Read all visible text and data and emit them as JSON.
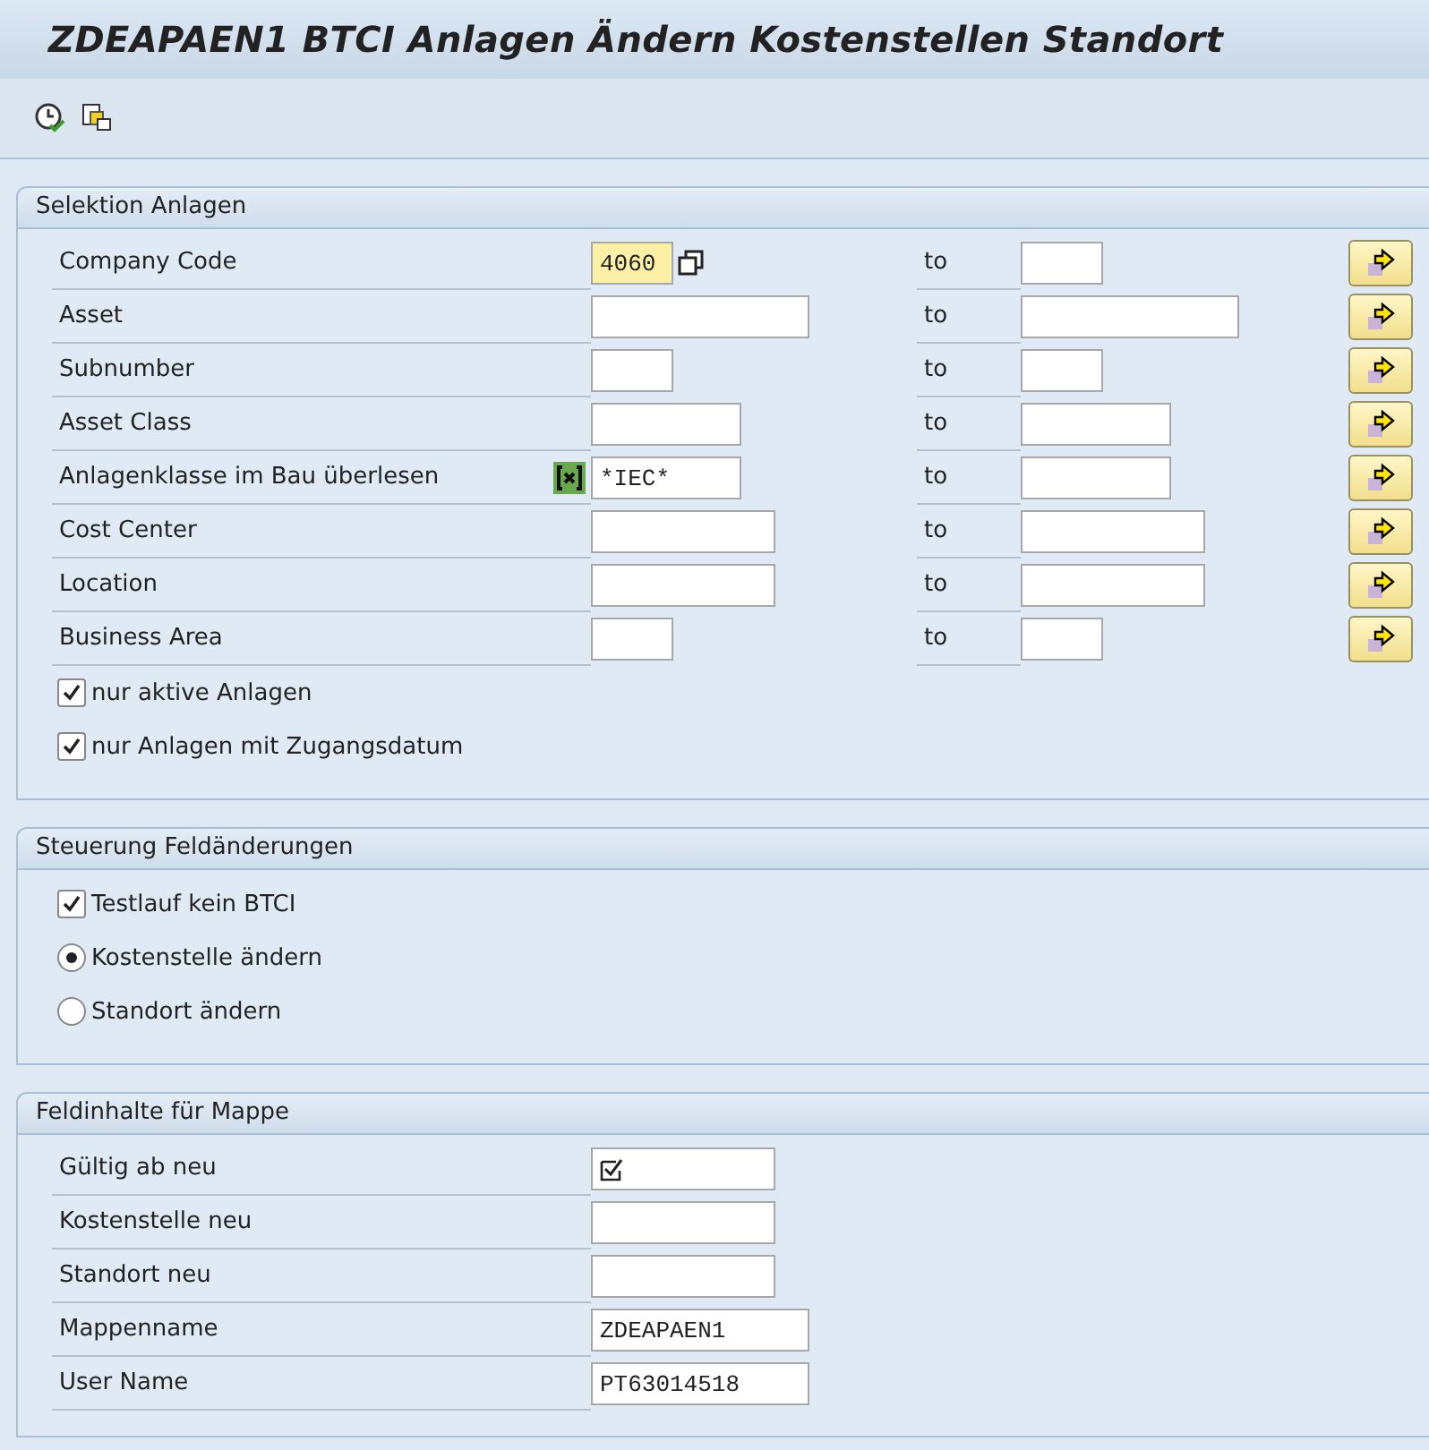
{
  "window": {
    "title": "ZDEAPAEN1  BTCI Anlagen Ändern Kostenstellen Standort"
  },
  "sections": [
    {
      "title": "Selektion Anlagen",
      "ranges": [
        {
          "label": "Company Code",
          "value": "4060",
          "highlighted": true,
          "multi_select": true,
          "exclude_marker": false,
          "to_label": "to"
        },
        {
          "label": "Asset",
          "highlighted": false,
          "multi_select": false,
          "exclude_marker": false,
          "to_label": "to"
        },
        {
          "label": "Subnumber",
          "highlighted": false,
          "multi_select": false,
          "exclude_marker": false,
          "to_label": "to"
        },
        {
          "label": "Asset Class",
          "highlighted": false,
          "multi_select": false,
          "exclude_marker": false,
          "to_label": "to"
        },
        {
          "label": "Anlagenklasse im Bau überlesen",
          "value": "*IEC*",
          "highlighted": false,
          "multi_select": false,
          "exclude_marker": true,
          "to_label": "to"
        },
        {
          "label": "Cost Center",
          "highlighted": false,
          "multi_select": false,
          "exclude_marker": false,
          "to_label": "to"
        },
        {
          "label": "Location",
          "highlighted": false,
          "multi_select": false,
          "exclude_marker": false,
          "to_label": "to"
        },
        {
          "label": "Business Area",
          "highlighted": false,
          "multi_select": false,
          "exclude_marker": false,
          "to_label": "to"
        }
      ],
      "options": [
        {
          "kind": "checkbox",
          "label": "nur aktive Anlagen",
          "checked": true
        },
        {
          "kind": "checkbox",
          "label": "nur Anlagen mit Zugangsdatum",
          "checked": true
        }
      ]
    },
    {
      "title": "Steuerung Feldänderungen",
      "options": [
        {
          "kind": "checkbox",
          "label": "Testlauf kein BTCI",
          "checked": true
        },
        {
          "kind": "radio",
          "label": "Kostenstelle ändern",
          "checked": true
        },
        {
          "kind": "radio",
          "label": "Standort ändern",
          "checked": false
        }
      ]
    },
    {
      "title": "Feldinhalte für Mappe",
      "fields": [
        {
          "label": "Gültig ab neu",
          "required": true
        },
        {
          "label": "Kostenstelle neu",
          "required": false
        },
        {
          "label": "Standort neu",
          "required": false
        },
        {
          "label": "Mappenname",
          "value": "ZDEAPAEN1",
          "required": false
        },
        {
          "label": "User Name",
          "value": "PT63014518",
          "required": false
        }
      ]
    }
  ]
}
